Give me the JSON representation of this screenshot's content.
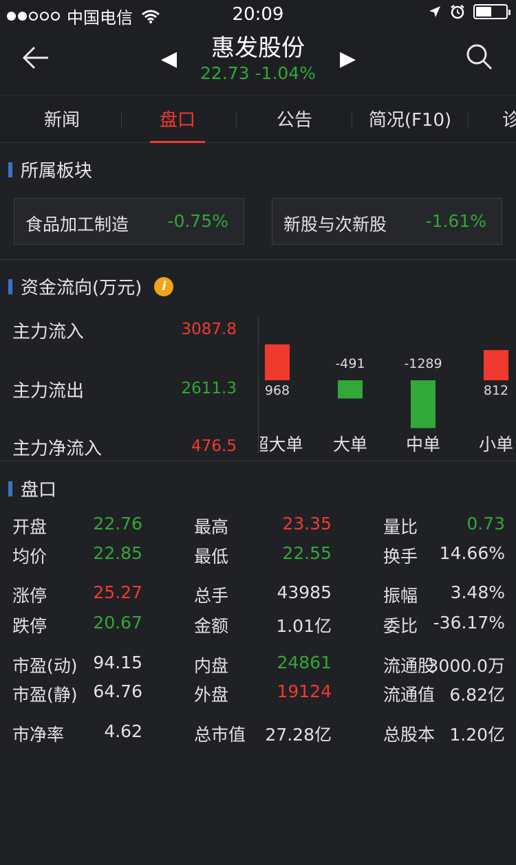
{
  "status": {
    "carrier": "中国电信",
    "time": "20:09"
  },
  "header": {
    "title": "惠发股份",
    "price_change": "22.73  -1.04%"
  },
  "tabs": [
    {
      "label": "新闻"
    },
    {
      "label": "盘口"
    },
    {
      "label": "公告"
    },
    {
      "label": "简况(F10)"
    },
    {
      "label": "诊"
    }
  ],
  "sectors": {
    "title": "所属板块",
    "items": [
      {
        "name": "食品加工制造",
        "value": "-0.75%"
      },
      {
        "name": "新股与次新股",
        "value": "-1.61%"
      }
    ]
  },
  "fund_flow": {
    "title": "资金流向(万元)",
    "info_glyph": "i",
    "rows": [
      {
        "label": "主力流入",
        "value": "3087.8"
      },
      {
        "label": "主力流出",
        "value": "2611.3"
      },
      {
        "label": "主力净流入",
        "value": "476.5"
      }
    ]
  },
  "chart_data": {
    "type": "bar",
    "categories": [
      "超大单",
      "大单",
      "中单",
      "小单"
    ],
    "values": [
      968,
      -491,
      -1289,
      812
    ],
    "data_labels": [
      "968",
      "-491",
      "-1289",
      "812"
    ]
  },
  "quote": {
    "title": "盘口",
    "rows": [
      [
        {
          "l": "开盘",
          "v": "22.76",
          "c": "green"
        },
        {
          "l": "最高",
          "v": "23.35",
          "c": "red"
        },
        {
          "l": "量比",
          "v": "0.73",
          "c": "green"
        }
      ],
      [
        {
          "l": "均价",
          "v": "22.85",
          "c": "green"
        },
        {
          "l": "最低",
          "v": "22.55",
          "c": "green"
        },
        {
          "l": "换手",
          "v": "14.66%",
          "c": "white"
        }
      ],
      [
        {
          "l": "涨停",
          "v": "25.27",
          "c": "red"
        },
        {
          "l": "总手",
          "v": "43985",
          "c": "white"
        },
        {
          "l": "振幅",
          "v": "3.48%",
          "c": "white"
        }
      ],
      [
        {
          "l": "跌停",
          "v": "20.67",
          "c": "green"
        },
        {
          "l": "金额",
          "v": "1.01亿",
          "c": "white"
        },
        {
          "l": "委比",
          "v": "-36.17%",
          "c": "white"
        }
      ],
      [
        {
          "l": "市盈(动)",
          "v": "94.15",
          "c": "white"
        },
        {
          "l": "内盘",
          "v": "24861",
          "c": "green"
        },
        {
          "l": "流通股",
          "v": "3000.0万",
          "c": "white"
        }
      ],
      [
        {
          "l": "市盈(静)",
          "v": "64.76",
          "c": "white"
        },
        {
          "l": "外盘",
          "v": "19124",
          "c": "red"
        },
        {
          "l": "流通值",
          "v": "6.82亿",
          "c": "white"
        }
      ],
      [
        {
          "l": "市净率",
          "v": "4.62",
          "c": "white"
        },
        {
          "l": "总市值",
          "v": "27.28亿",
          "c": "white"
        },
        {
          "l": "总股本",
          "v": "1.20亿",
          "c": "white"
        }
      ]
    ]
  },
  "colors": {
    "up": "#f03a2e",
    "down": "#31a838",
    "accent": "#3a72c9",
    "background": "#202125"
  }
}
